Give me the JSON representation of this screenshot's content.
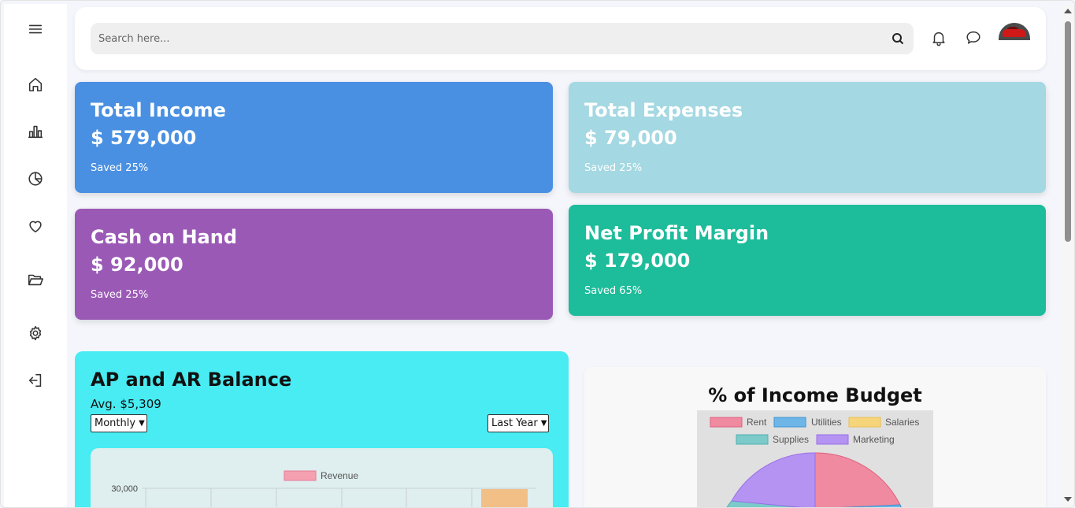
{
  "search": {
    "placeholder": "Search here..."
  },
  "sidebar": {
    "items": [
      {
        "icon": "menu-icon"
      },
      {
        "icon": "home-icon"
      },
      {
        "icon": "bar-chart-icon"
      },
      {
        "icon": "pie-chart-icon"
      },
      {
        "icon": "heart-icon"
      },
      {
        "icon": "folder-open-icon"
      },
      {
        "icon": "gear-icon"
      },
      {
        "icon": "logout-icon"
      }
    ]
  },
  "cards": {
    "income": {
      "title": "Total Income",
      "amount": "$ 579,000",
      "saved": "Saved 25%",
      "color": "#4a90e2"
    },
    "expenses": {
      "title": "Total Expenses",
      "amount": "$ 79,000",
      "saved": "Saved 25%",
      "color": "#a4d8e2"
    },
    "cash": {
      "title": "Cash on Hand",
      "amount": "$ 92,000",
      "saved": "Saved 25%",
      "color": "#9b59b6"
    },
    "profit": {
      "title": "Net Profit Margin",
      "amount": "$ 179,000",
      "saved": "Saved 65%",
      "color": "#1dbc9a"
    }
  },
  "ap": {
    "title": "AP and AR Balance",
    "avg": "Avg. $5,309",
    "period_select": "Monthly",
    "range_select": "Last Year"
  },
  "budget": {
    "title": "% of Income Budget"
  },
  "chart_data": [
    {
      "type": "bar",
      "title": "",
      "series": [
        {
          "name": "Revenue",
          "color": "#f4a0b0"
        }
      ],
      "y_ticks": [
        "30,000"
      ]
    },
    {
      "type": "pie",
      "title": "% of Income Budget",
      "legend": [
        {
          "label": "Rent",
          "color": "#f08aa0"
        },
        {
          "label": "Utilities",
          "color": "#6fb6e8"
        },
        {
          "label": "Salaries",
          "color": "#f6d47a"
        },
        {
          "label": "Supplies",
          "color": "#7ccaca"
        },
        {
          "label": "Marketing",
          "color": "#b593f2"
        }
      ]
    }
  ]
}
